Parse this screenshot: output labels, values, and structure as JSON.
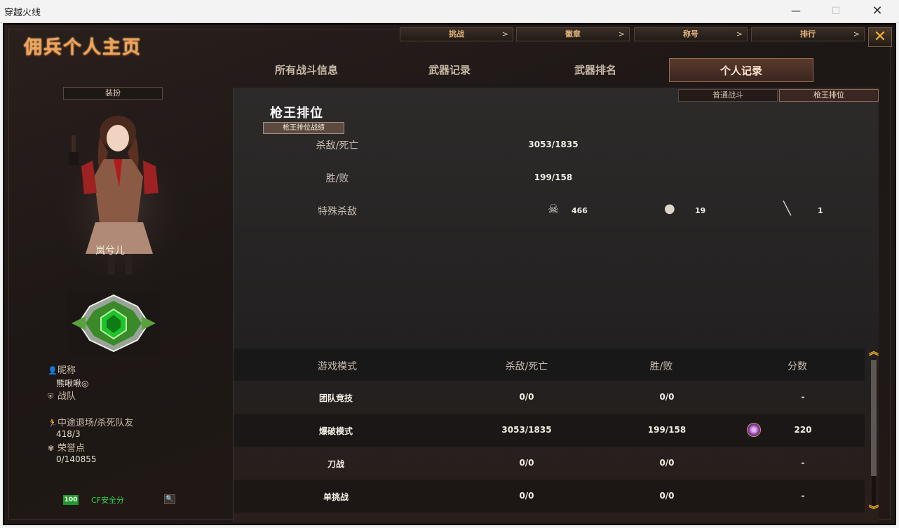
{
  "window": {
    "title": "穿越火线",
    "minimize": "—",
    "maximize": "☐",
    "close": "✕"
  },
  "page_title": "佣兵个人主页",
  "top_menu": [
    {
      "label": "挑战",
      "arrow": ">"
    },
    {
      "label": "徽章",
      "arrow": ">"
    },
    {
      "label": "称号",
      "arrow": ">"
    },
    {
      "label": "排行",
      "arrow": ">"
    }
  ],
  "close_button": "✕",
  "main_tabs": [
    {
      "label": "所有战斗信息",
      "active": false
    },
    {
      "label": "武器记录",
      "active": false
    },
    {
      "label": "武器排名",
      "active": false
    },
    {
      "label": "个人记录",
      "active": true
    }
  ],
  "left": {
    "outfit_button": "装扮",
    "character_name": "岚兮儿",
    "nickname_label": "昵称",
    "nickname_value": "熊啾啾◎",
    "team_label": "战队",
    "quit_label": "中途退场/杀死队友",
    "quit_value": "418/3",
    "honor_label": "荣誉点",
    "honor_value": "0/140855",
    "safety_score": "100",
    "safety_label": "CF安全分"
  },
  "sub_tabs": [
    {
      "label": "普通战斗",
      "active": false
    },
    {
      "label": "枪王排位",
      "active": true
    }
  ],
  "section": {
    "title": "枪王排位",
    "button": "枪王排位战绩"
  },
  "stats": {
    "kd_label": "杀敌/死亡",
    "kd_value": "3053/1835",
    "wl_label": "胜/败",
    "wl_value": "199/158",
    "special_label": "特殊杀敌",
    "special": [
      {
        "icon": "skull-crossbones-icon",
        "value": "466"
      },
      {
        "icon": "grenade-icon",
        "value": "19"
      },
      {
        "icon": "knife-icon",
        "value": "1"
      }
    ]
  },
  "table": {
    "headers": [
      "游戏模式",
      "杀敌/死亡",
      "胜/败",
      "分数"
    ],
    "rows": [
      {
        "mode": "团队竞技",
        "kd": "0/0",
        "wl": "0/0",
        "score": "-"
      },
      {
        "mode": "爆破模式",
        "kd": "3053/1835",
        "wl": "199/158",
        "score": "220"
      },
      {
        "mode": "刀战",
        "kd": "0/0",
        "wl": "0/0",
        "score": "-"
      },
      {
        "mode": "单挑战",
        "kd": "0/0",
        "wl": "0/0",
        "score": "-"
      }
    ]
  },
  "colors": {
    "accent_orange": "#f0a35a",
    "background": "#1d1715",
    "safety_green": "#1e9a2a"
  }
}
